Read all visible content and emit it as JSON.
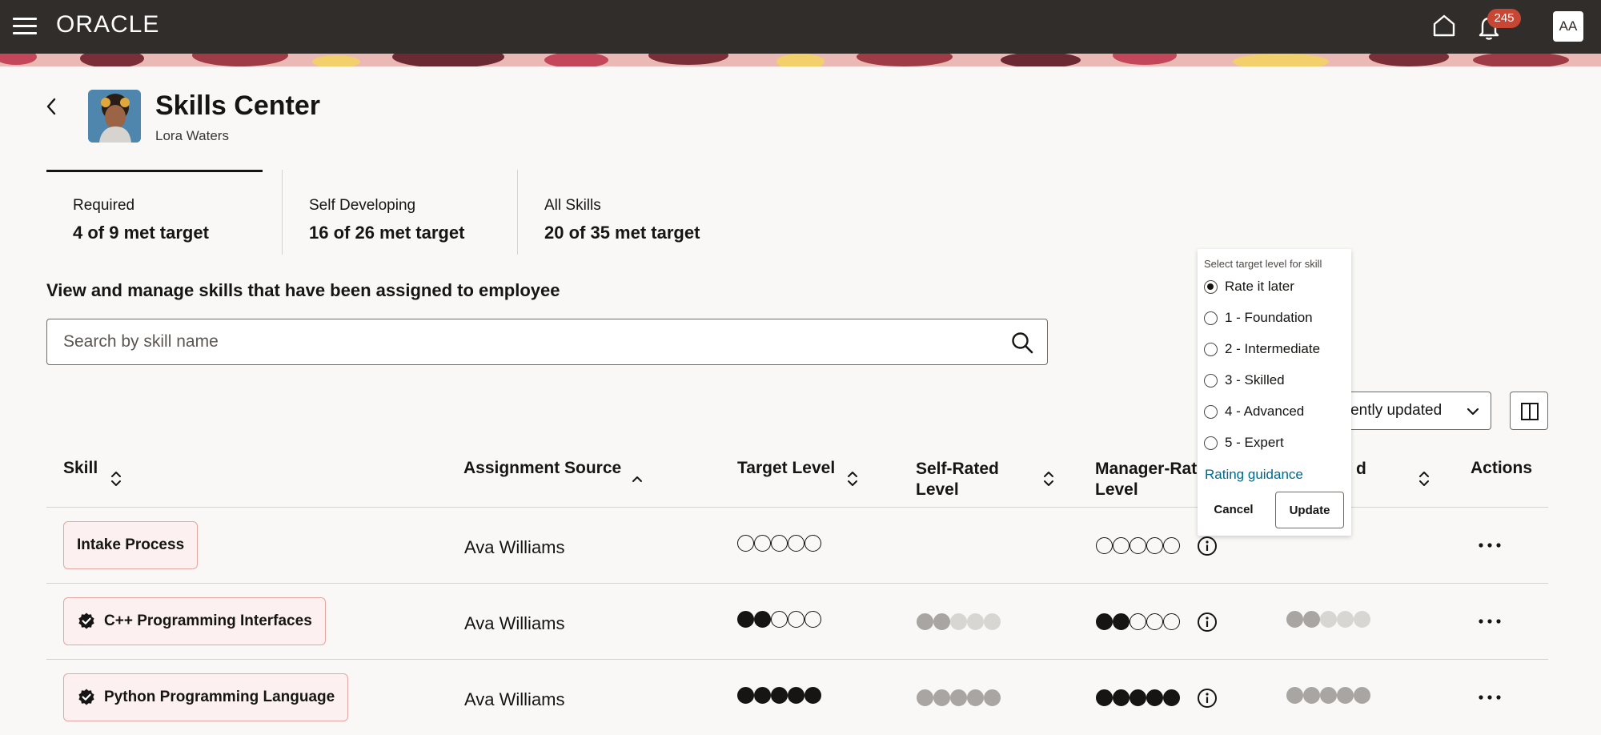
{
  "topbar": {
    "logo": "ORACLE",
    "notification_count": "245",
    "user_initials": "AA"
  },
  "header": {
    "title": "Skills Center",
    "subtitle": "Lora Waters"
  },
  "tabs": [
    {
      "label": "Required",
      "value": "4 of 9 met target"
    },
    {
      "label": "Self Developing",
      "value": "16 of 26 met target"
    },
    {
      "label": "All Skills",
      "value": "20 of 35 met target"
    }
  ],
  "section_heading": "View and manage skills that have been assigned to employee",
  "search": {
    "placeholder": "Search by skill name",
    "value": ""
  },
  "sort": {
    "selected": "ecently updated"
  },
  "table": {
    "columns": {
      "skill": "Skill",
      "assignment_source": "Assignment Source",
      "target_level": "Target Level",
      "self_rated_1": "Self-Rated",
      "self_rated_2": "Level",
      "manager_rated_1": "Manager-Rat",
      "manager_rated_2": "Level",
      "hidden_col": "d",
      "actions": "Actions"
    },
    "rows": [
      {
        "skill": "Intake Process",
        "verified": false,
        "source": "Ava Williams",
        "target_level": 0,
        "self_rated": null,
        "manager_rated": 0,
        "other_rated": null
      },
      {
        "skill": "C++ Programming Interfaces",
        "verified": true,
        "source": "Ava Williams",
        "target_level": 2,
        "self_rated": 2,
        "manager_rated": 2,
        "other_rated": 2
      },
      {
        "skill": "Python Programming Language",
        "verified": true,
        "source": "Ava Williams",
        "target_level": 5,
        "self_rated": 5,
        "manager_rated": 5,
        "other_rated": 5
      }
    ]
  },
  "popup": {
    "title": "Select target level for skill",
    "options": [
      "Rate it later",
      "1 - Foundation",
      "2 - Intermediate",
      "3 - Skilled",
      "4 - Advanced",
      "5 - Expert"
    ],
    "selected_index": 0,
    "link": "Rating guidance",
    "cancel": "Cancel",
    "update": "Update"
  },
  "colors": {
    "topbar": "#312d2a",
    "badge": "#c74634",
    "chip_border": "#e5a5a0",
    "link": "#00688c"
  }
}
